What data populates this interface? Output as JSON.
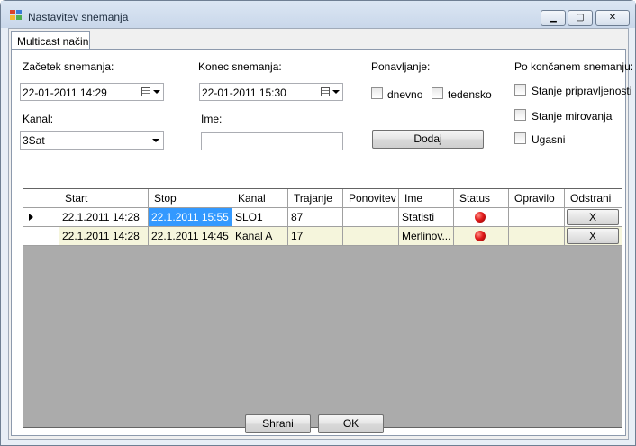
{
  "window": {
    "title": "Nastavitev snemanja"
  },
  "titlebar_buttons": {
    "minimize": "▁",
    "maximize": "▢",
    "close": "✕"
  },
  "tabs": [
    {
      "label": "Multicast način"
    }
  ],
  "form": {
    "start_label": "Začetek snemanja:",
    "start_value": "22-01-2011    14:29",
    "end_label": "Konec snemanja:",
    "end_value": "22-01-2011    15:30",
    "repeat_label": "Ponavljanje:",
    "daily_label": "dnevno",
    "weekly_label": "tedensko",
    "after_label": "Po končanem snemanju:",
    "standby_label": "Stanje pripravljenosti",
    "hibernate_label": "Stanje mirovanja",
    "shutdown_label": "Ugasni",
    "channel_label": "Kanal:",
    "channel_value": "3Sat",
    "name_label": "Ime:",
    "name_value": "",
    "add_button": "Dodaj"
  },
  "grid": {
    "columns": [
      "Start",
      "Stop",
      "Kanal",
      "Trajanje",
      "Ponovitev",
      "Ime",
      "Status",
      "Opravilo",
      "Odstrani"
    ],
    "rows": [
      {
        "start": "22.1.2011 14:28",
        "stop": "22.1.2011 15:55",
        "kanal": "SLO1",
        "trajanje": "87",
        "ponovitev": "",
        "ime": "Statisti",
        "opravilo": "",
        "odstrani": "X"
      },
      {
        "start": "22.1.2011 14:28",
        "stop": "22.1.2011 14:45",
        "kanal": "Kanal A",
        "trajanje": "17",
        "ponovitev": "",
        "ime": "Merlinov...",
        "opravilo": "",
        "odstrani": "X"
      }
    ]
  },
  "footer": {
    "save_button": "Shrani",
    "ok_button": "OK"
  },
  "colors": {
    "selected_cell": "#3399ff",
    "alt_row": "#f5f5dc",
    "status": "#d01010"
  }
}
